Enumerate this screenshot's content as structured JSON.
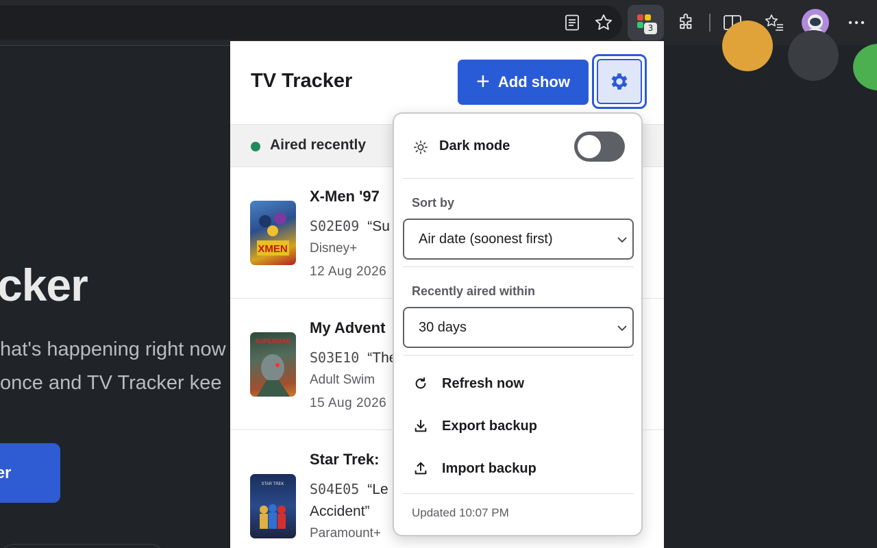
{
  "browser": {
    "extension_badge": "3"
  },
  "background": {
    "heading": "cker",
    "subtitle_line1": "hat's happening right now",
    "subtitle_line2": "once and TV Tracker kee",
    "button_label": "cker"
  },
  "popup": {
    "title": "TV Tracker",
    "add_button_label": "Add show",
    "section_label": "Aired recently",
    "shows": [
      {
        "title": "X-Men '97",
        "episode_code": "S02E09",
        "episode_title": "“Su",
        "network": "Disney+",
        "date": "12 Aug 2026"
      },
      {
        "title": "My Advent",
        "episode_code": "S03E10",
        "episode_title": "“The",
        "network": "Adult Swim",
        "date": "15 Aug 2026"
      },
      {
        "title": "Star Trek:",
        "episode_code": "S04E05",
        "episode_title": "“Le",
        "episode_title_cont": "Accident”",
        "network": "Paramount+",
        "date": ""
      }
    ]
  },
  "settings_menu": {
    "dark_mode_label": "Dark mode",
    "dark_mode_on": false,
    "sort_by_label": "Sort by",
    "sort_by_value": "Air date (soonest first)",
    "recent_label": "Recently aired within",
    "recent_value": "30 days",
    "refresh_label": "Refresh now",
    "export_label": "Export backup",
    "import_label": "Import backup",
    "updated_text": "Updated 10:07 PM"
  },
  "colors": {
    "accent": "#2a5bd7",
    "aired_dot": "#1f8a5a"
  }
}
